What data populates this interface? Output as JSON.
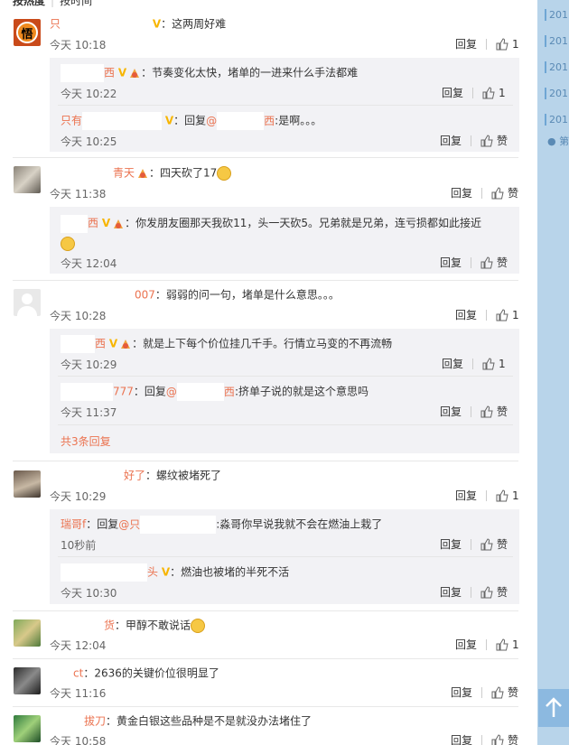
{
  "sort": {
    "hot": "按热度",
    "time": "按时间"
  },
  "sidebar": {
    "items": [
      "201",
      "201",
      "201",
      "201",
      "201"
    ],
    "first": "第一"
  },
  "actions": {
    "reply": "回复",
    "like": "赞"
  },
  "comments": [
    {
      "user": "只",
      "badge": "V",
      "text": "：这两周好难",
      "time": "今天 10:18",
      "likes": "1",
      "replies": [
        {
          "user": "西",
          "badge": "V",
          "text": "：节奏变化太快，堵单的一进来什么手法都难",
          "time": "今天 10:22",
          "likes": "1"
        },
        {
          "user": "只有",
          "badge": "V",
          "prefix": "：回复",
          "mention": "@",
          "mention_tail": "西",
          "text": ":是啊。。。",
          "time": "今天 10:25",
          "likes": "赞"
        }
      ]
    },
    {
      "user": "青天",
      "text": "：四天砍了17",
      "time": "今天 11:38",
      "likes": "赞",
      "replies": [
        {
          "user": "西",
          "badge": "V",
          "text": "：你发朋友圈那天我砍11，头一天砍5。兄弟就是兄弟，连亏损都如此接近",
          "time": "今天 12:04",
          "likes": "赞"
        }
      ]
    },
    {
      "user": "007",
      "text": "：弱弱的问一句，堵单是什么意思。。。",
      "time": "今天 10:28",
      "likes": "1",
      "replies": [
        {
          "user": "西",
          "badge": "V",
          "text": "：就是上下每个价位挂几千手。行情立马变的不再流畅",
          "time": "今天 10:29",
          "likes": "1"
        },
        {
          "user": "777",
          "prefix": "：回复",
          "mention": "@",
          "mention_tail": "西",
          "text": ":挤单子说的就是这个意思吗",
          "time": "今天 11:37",
          "likes": "赞"
        }
      ],
      "more": "共3条回复"
    },
    {
      "user": "好了",
      "text": "：螺纹被堵死了",
      "time": "今天 10:29",
      "likes": "1",
      "replies": [
        {
          "user": "瑞哥f",
          "prefix": "：回复",
          "mention": "@只",
          "text": ":淼哥你早说我就不会在燃油上栽了",
          "time": "10秒前",
          "likes": "赞"
        },
        {
          "user": "头",
          "badge": "V",
          "text": "：燃油也被堵的半死不活",
          "time": "今天 10:30",
          "likes": "赞"
        }
      ]
    },
    {
      "user": "货",
      "text": "：甲醇不敢说话",
      "time": "今天 12:04",
      "likes": "1"
    },
    {
      "user": "ct",
      "text": "：2636的关键价位很明显了",
      "time": "今天 11:16",
      "likes": "赞"
    },
    {
      "user": "拔刀",
      "text": "：黄金白银这些品种是不是就没办法堵住了",
      "time": "今天 10:58",
      "likes": "赞"
    }
  ]
}
